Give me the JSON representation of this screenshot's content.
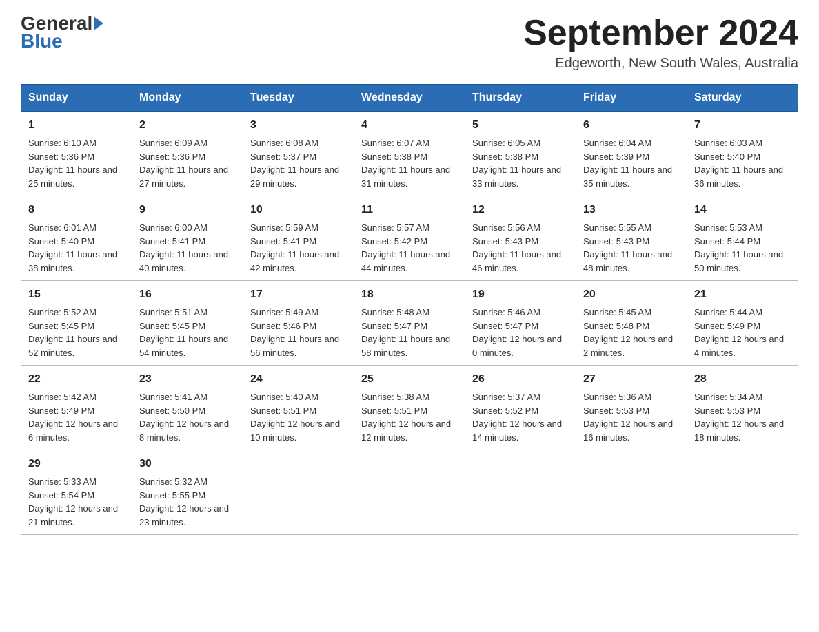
{
  "logo": {
    "general": "General",
    "blue": "Blue"
  },
  "title": "September 2024",
  "subtitle": "Edgeworth, New South Wales, Australia",
  "weekdays": [
    "Sunday",
    "Monday",
    "Tuesday",
    "Wednesday",
    "Thursday",
    "Friday",
    "Saturday"
  ],
  "weeks": [
    [
      {
        "day": "1",
        "sunrise": "6:10 AM",
        "sunset": "5:36 PM",
        "daylight": "11 hours and 25 minutes."
      },
      {
        "day": "2",
        "sunrise": "6:09 AM",
        "sunset": "5:36 PM",
        "daylight": "11 hours and 27 minutes."
      },
      {
        "day": "3",
        "sunrise": "6:08 AM",
        "sunset": "5:37 PM",
        "daylight": "11 hours and 29 minutes."
      },
      {
        "day": "4",
        "sunrise": "6:07 AM",
        "sunset": "5:38 PM",
        "daylight": "11 hours and 31 minutes."
      },
      {
        "day": "5",
        "sunrise": "6:05 AM",
        "sunset": "5:38 PM",
        "daylight": "11 hours and 33 minutes."
      },
      {
        "day": "6",
        "sunrise": "6:04 AM",
        "sunset": "5:39 PM",
        "daylight": "11 hours and 35 minutes."
      },
      {
        "day": "7",
        "sunrise": "6:03 AM",
        "sunset": "5:40 PM",
        "daylight": "11 hours and 36 minutes."
      }
    ],
    [
      {
        "day": "8",
        "sunrise": "6:01 AM",
        "sunset": "5:40 PM",
        "daylight": "11 hours and 38 minutes."
      },
      {
        "day": "9",
        "sunrise": "6:00 AM",
        "sunset": "5:41 PM",
        "daylight": "11 hours and 40 minutes."
      },
      {
        "day": "10",
        "sunrise": "5:59 AM",
        "sunset": "5:41 PM",
        "daylight": "11 hours and 42 minutes."
      },
      {
        "day": "11",
        "sunrise": "5:57 AM",
        "sunset": "5:42 PM",
        "daylight": "11 hours and 44 minutes."
      },
      {
        "day": "12",
        "sunrise": "5:56 AM",
        "sunset": "5:43 PM",
        "daylight": "11 hours and 46 minutes."
      },
      {
        "day": "13",
        "sunrise": "5:55 AM",
        "sunset": "5:43 PM",
        "daylight": "11 hours and 48 minutes."
      },
      {
        "day": "14",
        "sunrise": "5:53 AM",
        "sunset": "5:44 PM",
        "daylight": "11 hours and 50 minutes."
      }
    ],
    [
      {
        "day": "15",
        "sunrise": "5:52 AM",
        "sunset": "5:45 PM",
        "daylight": "11 hours and 52 minutes."
      },
      {
        "day": "16",
        "sunrise": "5:51 AM",
        "sunset": "5:45 PM",
        "daylight": "11 hours and 54 minutes."
      },
      {
        "day": "17",
        "sunrise": "5:49 AM",
        "sunset": "5:46 PM",
        "daylight": "11 hours and 56 minutes."
      },
      {
        "day": "18",
        "sunrise": "5:48 AM",
        "sunset": "5:47 PM",
        "daylight": "11 hours and 58 minutes."
      },
      {
        "day": "19",
        "sunrise": "5:46 AM",
        "sunset": "5:47 PM",
        "daylight": "12 hours and 0 minutes."
      },
      {
        "day": "20",
        "sunrise": "5:45 AM",
        "sunset": "5:48 PM",
        "daylight": "12 hours and 2 minutes."
      },
      {
        "day": "21",
        "sunrise": "5:44 AM",
        "sunset": "5:49 PM",
        "daylight": "12 hours and 4 minutes."
      }
    ],
    [
      {
        "day": "22",
        "sunrise": "5:42 AM",
        "sunset": "5:49 PM",
        "daylight": "12 hours and 6 minutes."
      },
      {
        "day": "23",
        "sunrise": "5:41 AM",
        "sunset": "5:50 PM",
        "daylight": "12 hours and 8 minutes."
      },
      {
        "day": "24",
        "sunrise": "5:40 AM",
        "sunset": "5:51 PM",
        "daylight": "12 hours and 10 minutes."
      },
      {
        "day": "25",
        "sunrise": "5:38 AM",
        "sunset": "5:51 PM",
        "daylight": "12 hours and 12 minutes."
      },
      {
        "day": "26",
        "sunrise": "5:37 AM",
        "sunset": "5:52 PM",
        "daylight": "12 hours and 14 minutes."
      },
      {
        "day": "27",
        "sunrise": "5:36 AM",
        "sunset": "5:53 PM",
        "daylight": "12 hours and 16 minutes."
      },
      {
        "day": "28",
        "sunrise": "5:34 AM",
        "sunset": "5:53 PM",
        "daylight": "12 hours and 18 minutes."
      }
    ],
    [
      {
        "day": "29",
        "sunrise": "5:33 AM",
        "sunset": "5:54 PM",
        "daylight": "12 hours and 21 minutes."
      },
      {
        "day": "30",
        "sunrise": "5:32 AM",
        "sunset": "5:55 PM",
        "daylight": "12 hours and 23 minutes."
      },
      null,
      null,
      null,
      null,
      null
    ]
  ],
  "labels": {
    "sunrise": "Sunrise:",
    "sunset": "Sunset:",
    "daylight": "Daylight:"
  }
}
